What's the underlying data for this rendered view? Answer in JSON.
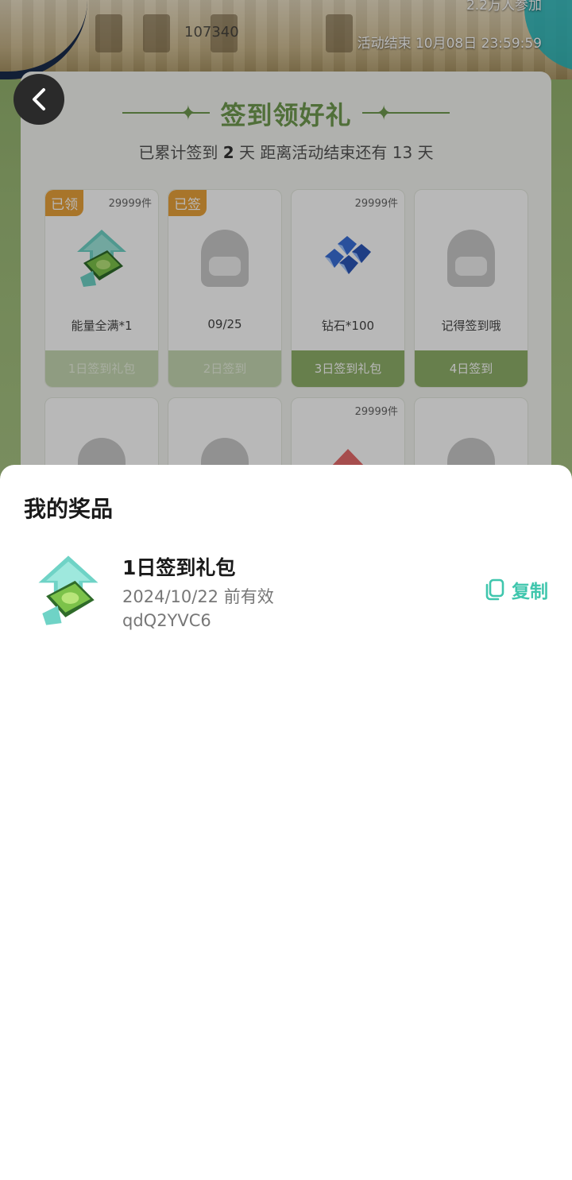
{
  "banner": {
    "participants": "2.2万人参加",
    "end_time": "活动结束 10月08日 23:59:59",
    "faint_number": "107340"
  },
  "checkin": {
    "title": "签到领好礼",
    "subtitle_prefix": "已累计签到",
    "days_checked": "2",
    "subtitle_mid": "天  距离活动结束还有",
    "days_left": "13",
    "subtitle_suffix": "天",
    "tiles": [
      {
        "badge": "已领",
        "count": "29999件",
        "name": "能量全满*1",
        "foot": "1日签到礼包",
        "icon": "energy-pack-icon",
        "done": true
      },
      {
        "badge": "已签",
        "count": "",
        "name": "09/25",
        "foot": "2日签到",
        "icon": "placeholder-mascot-icon",
        "done": true
      },
      {
        "badge": "",
        "count": "29999件",
        "name": "钻石*100",
        "foot": "3日签到礼包",
        "icon": "diamond-icon",
        "done": false
      },
      {
        "badge": "",
        "count": "",
        "name": "记得签到哦",
        "foot": "4日签到",
        "icon": "placeholder-mascot-icon",
        "done": false
      }
    ],
    "row2_count": "29999件"
  },
  "sheet": {
    "title": "我的奖品",
    "prize": {
      "name": "1日签到礼包",
      "valid": "2024/10/22 前有效",
      "code": "qdQ2YVC6",
      "copy_label": "复制",
      "icon": "energy-pack-icon"
    }
  },
  "colors": {
    "accent_green": "#6f9a4f",
    "copy_teal": "#3fc6ad",
    "badge_orange": "#e9a23b"
  }
}
